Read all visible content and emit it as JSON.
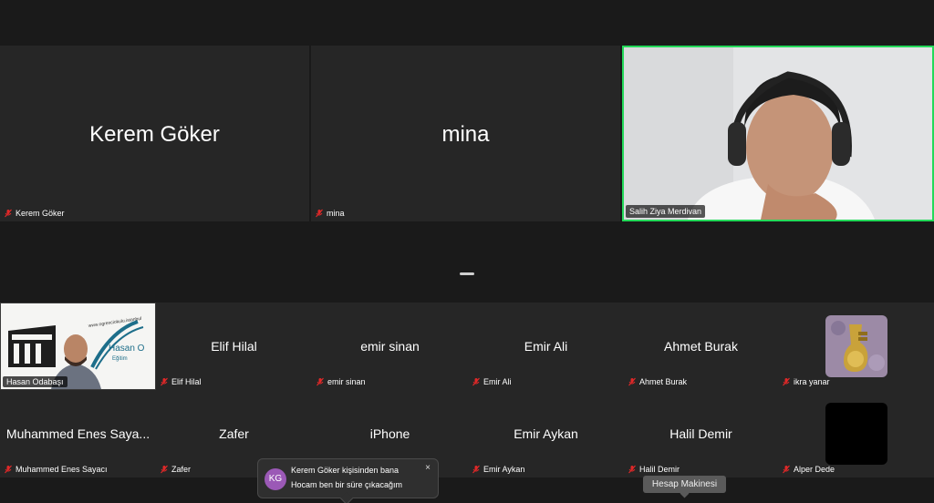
{
  "speakers": {
    "kerem": {
      "name": "Kerem Göker",
      "label": "Kerem Göker"
    },
    "mina": {
      "name": "mina",
      "label": "mina"
    },
    "salih": {
      "label": "Salih Ziya Merdivan"
    }
  },
  "grid": {
    "hasan": {
      "label": "Hasan Odabaşı",
      "slide_text": "www.ogrenciokulu.istanbul",
      "slide_title": "Hasan O",
      "slide_sub": "Eğitim"
    },
    "elif": {
      "name": "Elif Hilal",
      "label": "Elif Hilal"
    },
    "emir_sinan": {
      "name": "emir sinan",
      "label": "emir sinan"
    },
    "emir_ali": {
      "name": "Emir Ali",
      "label": "Emir Ali"
    },
    "ahmet": {
      "name": "Ahmet Burak",
      "label": "Ahmet Burak"
    },
    "ikra": {
      "label": "ikra yanar"
    },
    "muhammed": {
      "name": "Muhammed Enes Saya...",
      "label": "Muhammed Enes Sayacı"
    },
    "zafer": {
      "name": "Zafer",
      "label": "Zafer"
    },
    "iphone": {
      "name": "iPhone"
    },
    "emir_aykan": {
      "name": "Emir Aykan",
      "label": "Emir Aykan"
    },
    "halil": {
      "name": "Halil Demir",
      "label": "Halil Demir"
    },
    "alper": {
      "label": "Alper Dede"
    }
  },
  "toast": {
    "initials": "KG",
    "line1": "Kerem Göker kişisinden bana",
    "line2": "Hocam ben bir süre çıkacağım",
    "close": "×"
  },
  "tooltip": {
    "text": "Hesap Makinesi"
  },
  "colors": {
    "background": "#1a1a1a",
    "tile": "#262626",
    "active_speaker_border": "#23d959",
    "muted_icon": "#e02828",
    "avatar_kg": "#9b59b6"
  }
}
